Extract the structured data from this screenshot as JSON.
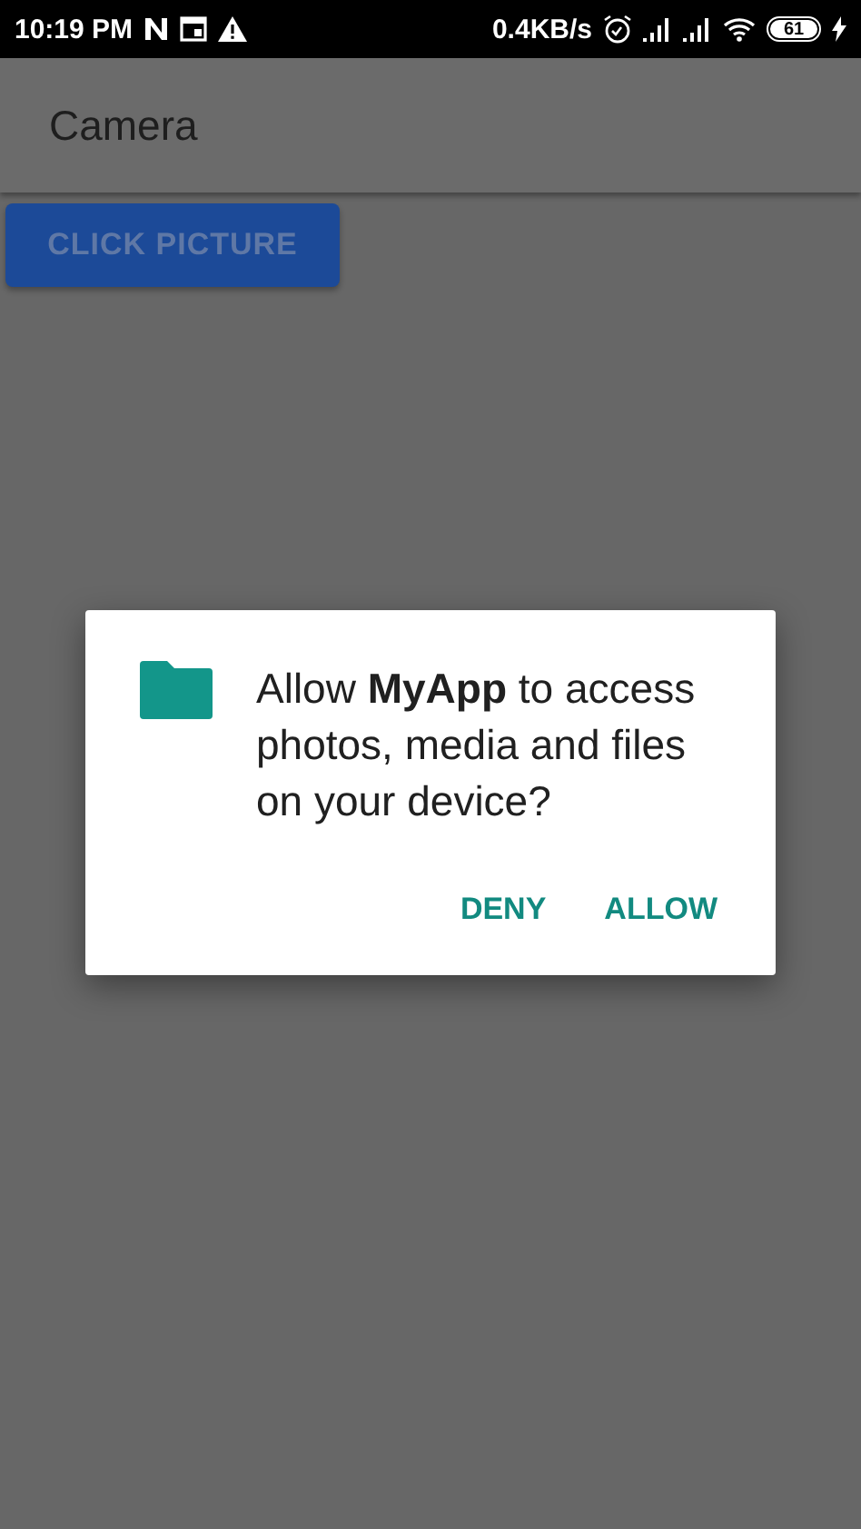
{
  "status_bar": {
    "time": "10:19 PM",
    "speed": "0.4KB/s",
    "battery": "61"
  },
  "app_bar": {
    "title": "Camera"
  },
  "button": {
    "label": "CLICK PICTURE"
  },
  "dialog": {
    "message": "Allow **MyApp** to access photos, media and files on your device?",
    "buttons": [
      "DENY",
      "ALLOW"
    ]
  }
}
